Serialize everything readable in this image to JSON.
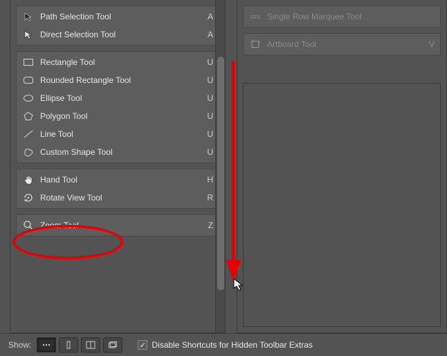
{
  "left": {
    "groups": [
      [
        {
          "id": "path-selection",
          "label": "Path Selection Tool",
          "key": "A",
          "icon": "arrow-black"
        },
        {
          "id": "direct-selection",
          "label": "Direct Selection Tool",
          "key": "A",
          "icon": "arrow-white"
        }
      ],
      [
        {
          "id": "rectangle",
          "label": "Rectangle Tool",
          "key": "U",
          "icon": "rect"
        },
        {
          "id": "rounded-rectangle",
          "label": "Rounded Rectangle Tool",
          "key": "U",
          "icon": "roundrect"
        },
        {
          "id": "ellipse",
          "label": "Ellipse Tool",
          "key": "U",
          "icon": "ellipse"
        },
        {
          "id": "polygon",
          "label": "Polygon Tool",
          "key": "U",
          "icon": "polygon"
        },
        {
          "id": "line",
          "label": "Line Tool",
          "key": "U",
          "icon": "line"
        },
        {
          "id": "custom-shape",
          "label": "Custom Shape Tool",
          "key": "U",
          "icon": "blob"
        }
      ],
      [
        {
          "id": "hand",
          "label": "Hand Tool",
          "key": "H",
          "icon": "hand"
        },
        {
          "id": "rotate-view",
          "label": "Rotate View Tool",
          "key": "R",
          "icon": "rotate"
        }
      ],
      [
        {
          "id": "zoom",
          "label": "Zoom Tool",
          "key": "Z",
          "icon": "zoom"
        }
      ]
    ]
  },
  "right": {
    "groups": [
      [
        {
          "id": "single-row-marquee",
          "label": "Single Row Marquee Tool",
          "key": "",
          "icon": "row-marquee",
          "dimmed": true
        }
      ],
      [
        {
          "id": "artboard",
          "label": "Artboard Tool",
          "key": "V",
          "icon": "artboard",
          "dimmed": true
        }
      ]
    ]
  },
  "footer": {
    "show_label": "Show:",
    "checkbox_label": "Disable Shortcuts for Hidden Toolbar Extras",
    "checkbox_checked": true
  },
  "colors": {
    "annot": "#e60000"
  }
}
